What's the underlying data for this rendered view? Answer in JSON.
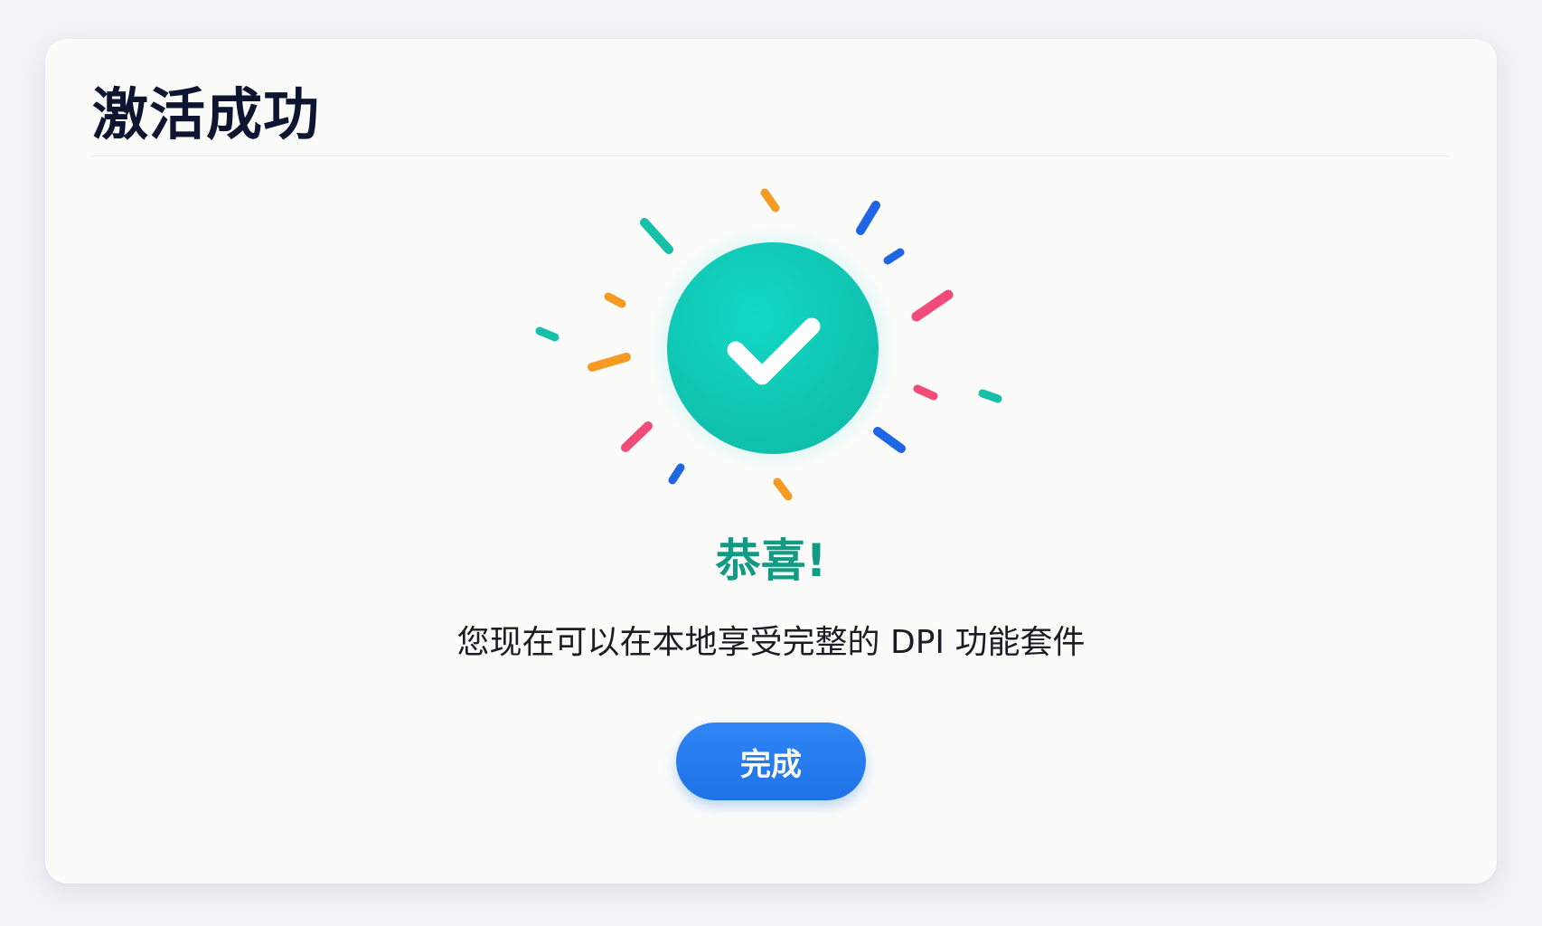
{
  "dialog": {
    "title": "激活成功",
    "heading": "恭喜!",
    "message": "您现在可以在本地享受完整的 DPI 功能套件",
    "done_label": "完成"
  },
  "icons": {
    "success": "check-circle-icon"
  },
  "colors": {
    "title": "#0d1530",
    "heading": "#139a83",
    "success": "#12c7b4",
    "primary": "#1e72e8",
    "confetti_teal": "#16bfa8",
    "confetti_orange": "#f59a23",
    "confetti_blue": "#1f66e5",
    "confetti_pink": "#ef4c78"
  }
}
